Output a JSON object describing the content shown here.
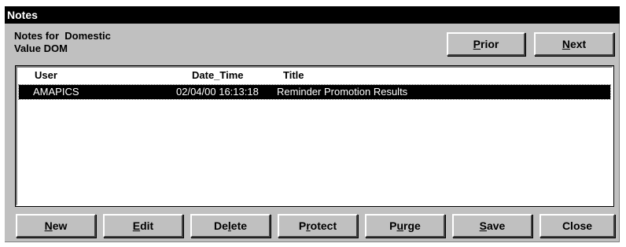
{
  "window": {
    "title": "Notes"
  },
  "header": {
    "line1": "Notes for  Domestic",
    "line2": "Value DOM"
  },
  "nav": {
    "prior": {
      "pre": "",
      "ul": "P",
      "post": "rior"
    },
    "next": {
      "pre": "",
      "ul": "N",
      "post": "ext"
    }
  },
  "table": {
    "columns": {
      "user": "User",
      "date_time": "Date_Time",
      "title": "Title"
    },
    "rows": [
      {
        "user": "AMAPICS",
        "date_time": "02/04/00 16:13:18",
        "title": "Reminder Promotion Results",
        "selected": true
      }
    ]
  },
  "actions": {
    "new": {
      "pre": "",
      "ul": "N",
      "post": "ew"
    },
    "edit": {
      "pre": "",
      "ul": "E",
      "post": "dit"
    },
    "delete": {
      "pre": "De",
      "ul": "l",
      "post": "ete"
    },
    "protect": {
      "pre": "P",
      "ul": "r",
      "post": "otect"
    },
    "purge": {
      "pre": "P",
      "ul": "u",
      "post": "rge"
    },
    "save": {
      "pre": "",
      "ul": "S",
      "post": "ave"
    },
    "close": {
      "pre": "",
      "ul": "",
      "post": "Close"
    }
  }
}
